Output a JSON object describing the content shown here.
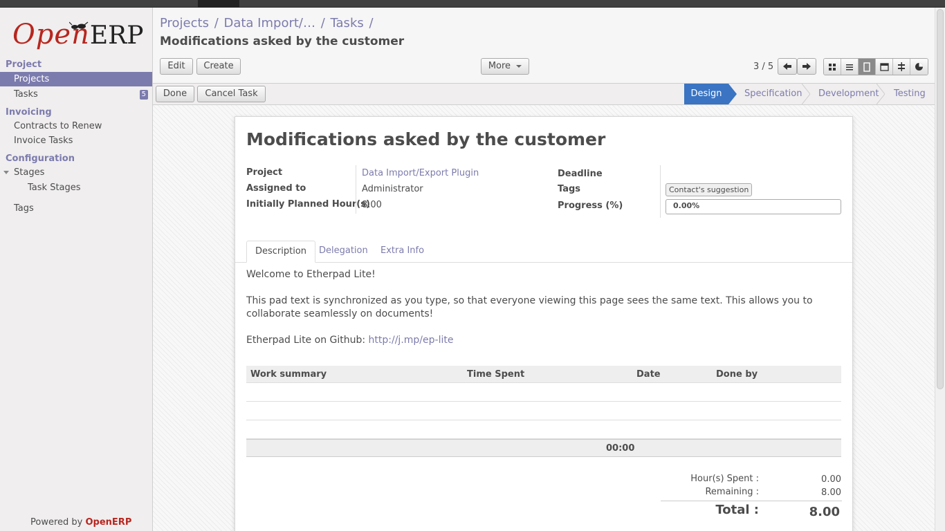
{
  "sidebar": {
    "brand_open": "Open",
    "brand_erp": "ERP",
    "sections": {
      "project": "Project",
      "invoicing": "Invoicing",
      "configuration": "Configuration"
    },
    "items": {
      "projects": "Projects",
      "tasks": "Tasks",
      "tasks_badge": "5",
      "contracts": "Contracts to Renew",
      "invoice_tasks": "Invoice Tasks",
      "stages": "Stages",
      "task_stages": "Task Stages",
      "tags": "Tags"
    },
    "powered_by": "Powered by",
    "powered_brand": "OpenERP"
  },
  "header": {
    "breadcrumb": [
      "Projects",
      "Data Import/…",
      "Tasks"
    ],
    "title": "Modifications asked by the customer",
    "edit_label": "Edit",
    "create_label": "Create",
    "more_label": "More",
    "pager": "3 / 5"
  },
  "statusbar": {
    "done_label": "Done",
    "cancel_label": "Cancel Task",
    "stages": [
      "Design",
      "Specification",
      "Development",
      "Testing"
    ],
    "current_stage": "Design"
  },
  "form": {
    "title": "Modifications asked by the customer",
    "labels": {
      "project": "Project",
      "assigned": "Assigned to",
      "planned": "Initially Planned Hour(s)",
      "deadline": "Deadline",
      "tags": "Tags",
      "progress": "Progress (%)"
    },
    "values": {
      "project": "Data Import/Export Plugin",
      "assigned": "Administrator",
      "planned": "8.00",
      "deadline": "",
      "tag": "Contact's suggestion",
      "progress": "0.00%",
      "progress_fraction": 0.0
    },
    "tabs": [
      "Description",
      "Delegation",
      "Extra Info"
    ],
    "description": {
      "line1": "Welcome to Etherpad Lite!",
      "line2": "This pad text is synchronized as you type, so that everyone viewing this page sees the same text. This allows you to collaborate seamlessly on documents!",
      "line3_prefix": "Etherpad Lite on Github: ",
      "line3_link": "http://j.mp/ep-lite"
    },
    "work_table": {
      "headers": [
        "Work summary",
        "Time Spent",
        "Date",
        "Done by"
      ],
      "rows": [],
      "total": "00:00"
    },
    "totals": {
      "spent_label": "Hour(s) Spent :",
      "spent_value": "0.00",
      "remaining_label": "Remaining :",
      "remaining_value": "8.00",
      "total_label": "Total :",
      "total_value": "8.00"
    }
  },
  "colors": {
    "accent": "#7c7bad",
    "brand_red": "#b7261f",
    "stage_current": "#3a74c2"
  }
}
